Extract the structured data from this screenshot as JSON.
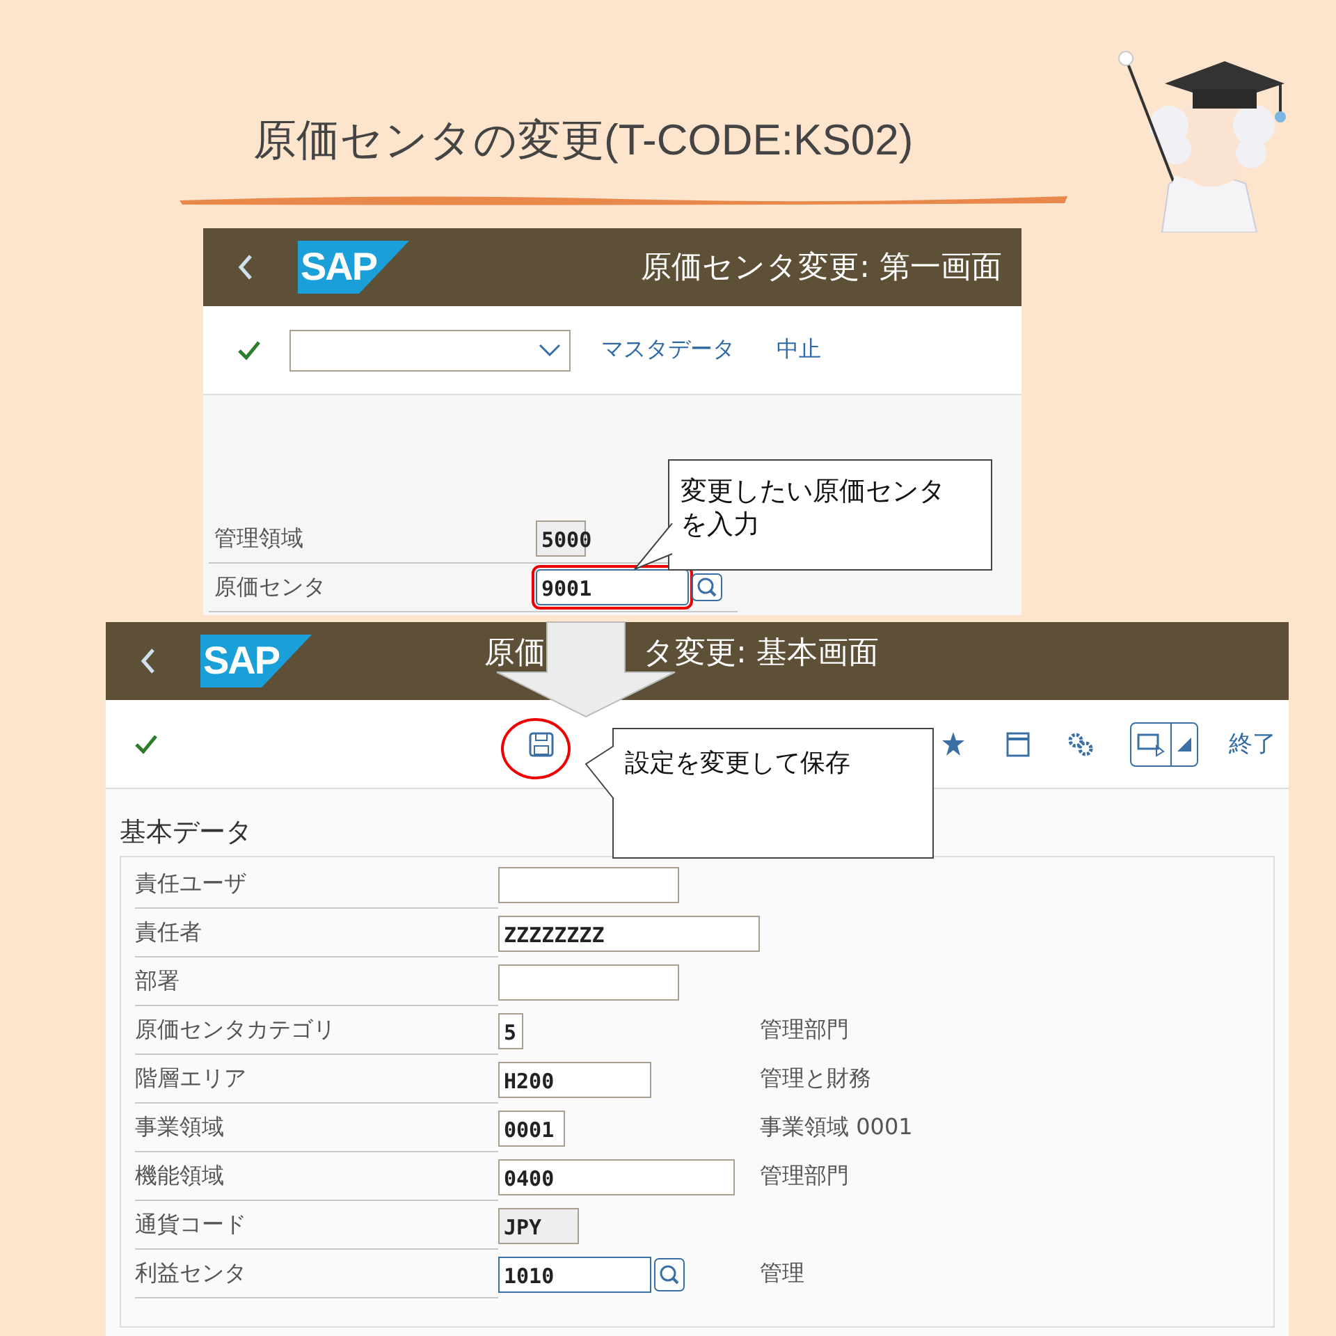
{
  "title": "原価センタの変更(T-CODE:KS02)",
  "screen_1": {
    "logo": "SAP",
    "title": "原価センタ変更: 第一画面",
    "links": [
      "マスタデータ",
      "中止"
    ],
    "fields": [
      {
        "label": "管理領域",
        "value": "5000",
        "kind": "display",
        "highlighted": false
      },
      {
        "label": "原価センタ",
        "value": "9001",
        "kind": "focused",
        "highlighted": true
      }
    ]
  },
  "callout_1": {
    "text": "変更したい原価センタを入力"
  },
  "screen_2": {
    "logo": "SAP",
    "title_parts": [
      "原価",
      "タ変更: 基本画面"
    ],
    "save_highlighted": true,
    "exit": "終了",
    "section": "基本データ",
    "fields": [
      {
        "label": "責任ユーザ",
        "kind": "input"
      },
      {
        "label": "責任者",
        "value": "ZZZZZZZZ",
        "kind": "input"
      },
      {
        "label": "部署",
        "kind": "input"
      },
      {
        "label": "原価センタカテゴリ",
        "value": "5",
        "kind": "input",
        "description": "管理部門"
      },
      {
        "label": "階層エリア",
        "value": "H200",
        "kind": "input",
        "description": "管理と財務"
      },
      {
        "label": "事業領域",
        "value": "0001",
        "kind": "input",
        "description": "事業領域 0001"
      },
      {
        "label": "機能領域",
        "value": "0400",
        "kind": "input",
        "description": "管理部門"
      },
      {
        "label": "通貨コード",
        "value": "JPY",
        "kind": "display"
      },
      {
        "label": "利益センタ",
        "value": "1010",
        "kind": "focused",
        "description": "管理"
      }
    ]
  },
  "callout_2": {
    "text": "設定を変更して保存"
  }
}
